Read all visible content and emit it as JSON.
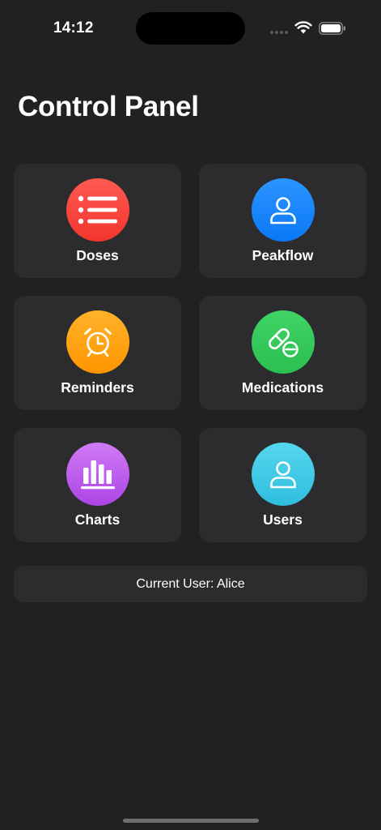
{
  "status_bar": {
    "time": "14:12"
  },
  "header": {
    "title": "Control Panel"
  },
  "tiles": [
    {
      "label": "Doses",
      "icon": "list-icon",
      "color": "#f2352e"
    },
    {
      "label": "Peakflow",
      "icon": "person-icon",
      "color": "#0a78f5"
    },
    {
      "label": "Reminders",
      "icon": "alarm-clock-icon",
      "color": "#ff9500"
    },
    {
      "label": "Medications",
      "icon": "pills-icon",
      "color": "#2bbf50"
    },
    {
      "label": "Charts",
      "icon": "bar-chart-icon",
      "color": "#ad44e6"
    },
    {
      "label": "Users",
      "icon": "person-icon",
      "color": "#2fbede"
    }
  ],
  "footer": {
    "current_user": "Current User: Alice"
  }
}
